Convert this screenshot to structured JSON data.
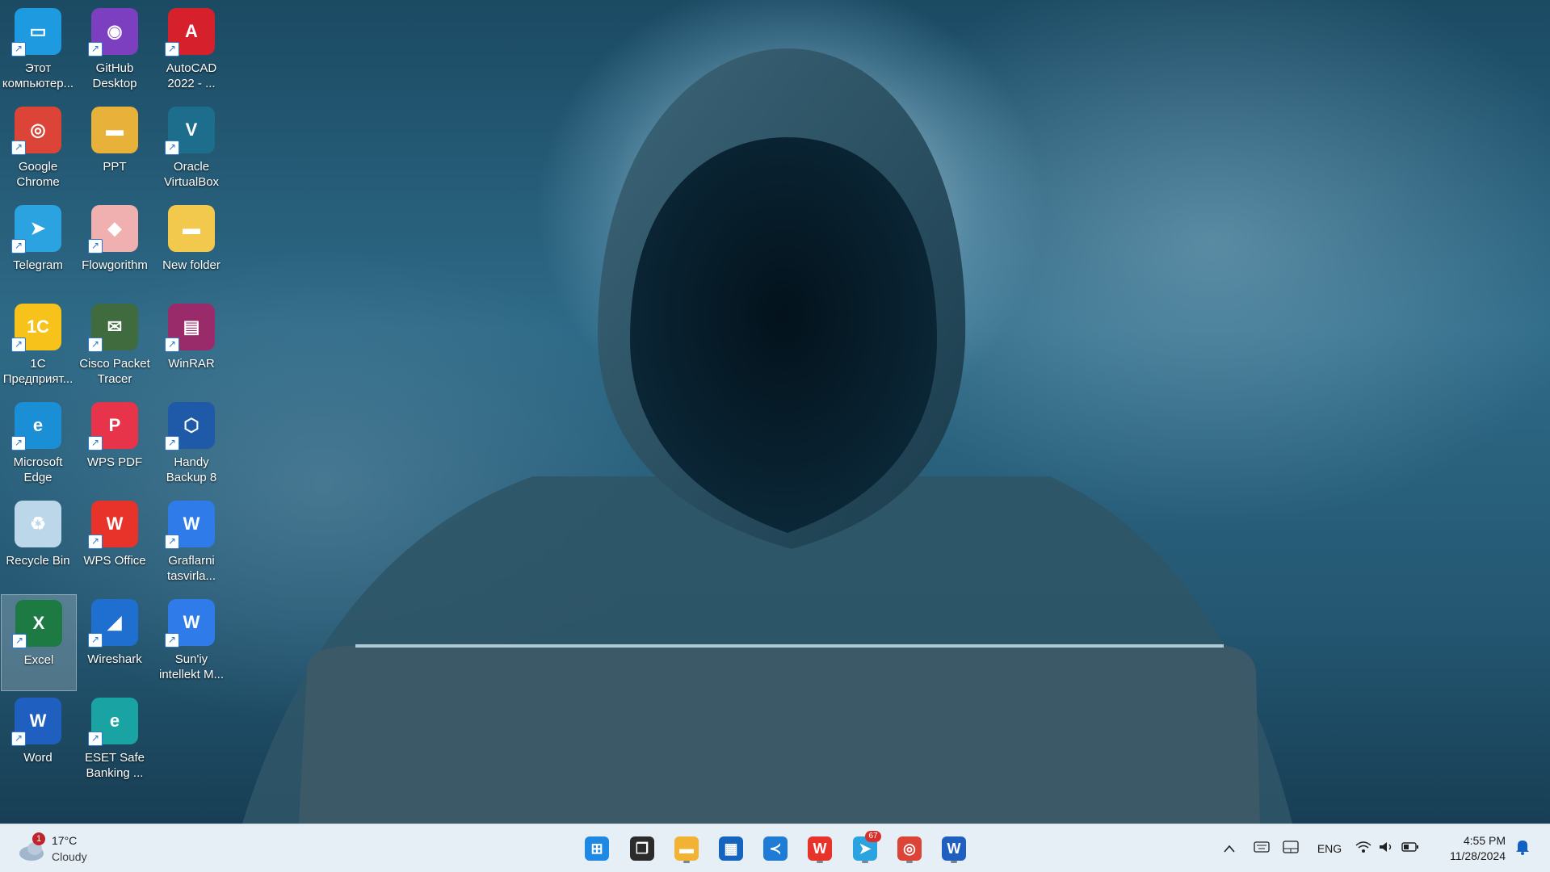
{
  "desktop": {
    "icons": [
      {
        "label": "Этот\nкомпьютер...",
        "icon": "computer-icon",
        "color": "#1e9be0"
      },
      {
        "label": "GitHub\nDesktop",
        "icon": "github-icon",
        "color": "#7b3fbf"
      },
      {
        "label": "AutoCAD\n2022 - ...",
        "icon": "autocad-icon",
        "color": "#d6202b"
      },
      {
        "label": "Google\nChrome",
        "icon": "chrome-icon",
        "color": "#db4437"
      },
      {
        "label": "PPT",
        "icon": "folder-icon",
        "color": "#e8b13a"
      },
      {
        "label": "Oracle\nVirtualBox",
        "icon": "virtualbox-icon",
        "color": "#1c6e8c"
      },
      {
        "label": "Telegram",
        "icon": "telegram-icon",
        "color": "#2aa3e0"
      },
      {
        "label": "Flowgorithm",
        "icon": "flowgorithm-icon",
        "color": "#f0b0b0"
      },
      {
        "label": "New folder",
        "icon": "folder-icon",
        "color": "#f2c94c"
      },
      {
        "label": "1C\nПредприят...",
        "icon": "1c-icon",
        "color": "#f7c21a"
      },
      {
        "label": "Cisco Packet\nTracer",
        "icon": "packet-tracer-icon",
        "color": "#3f6b3f"
      },
      {
        "label": "WinRAR",
        "icon": "winrar-icon",
        "color": "#9a2b6b"
      },
      {
        "label": "Microsoft\nEdge",
        "icon": "edge-icon",
        "color": "#1a8fd6"
      },
      {
        "label": "WPS PDF",
        "icon": "wps-pdf-icon",
        "color": "#e8344a"
      },
      {
        "label": "Handy\nBackup 8",
        "icon": "handy-backup-icon",
        "color": "#1e5aa8"
      },
      {
        "label": "Recycle Bin",
        "icon": "recycle-bin-icon",
        "color": "#bcd7ea"
      },
      {
        "label": "WPS Office",
        "icon": "wps-office-icon",
        "color": "#e8332a"
      },
      {
        "label": "Graflarni\ntasvirla...",
        "icon": "wps-doc-icon",
        "color": "#2f7bea"
      },
      {
        "label": "Excel",
        "icon": "excel-icon",
        "color": "#1d7a43"
      },
      {
        "label": "Wireshark",
        "icon": "wireshark-icon",
        "color": "#1e6fd0"
      },
      {
        "label": "Sun'iy\nintellekt M...",
        "icon": "wps-doc-icon",
        "color": "#2f7bea"
      },
      {
        "label": "Word",
        "icon": "word-icon",
        "color": "#1f5fbf"
      },
      {
        "label": "ESET Safe\nBanking ...",
        "icon": "eset-icon",
        "color": "#1aa3a3"
      }
    ]
  },
  "taskbar": {
    "weather": {
      "temp": "17°C",
      "desc": "Cloudy",
      "badge": "1"
    },
    "apps": [
      {
        "icon": "start-icon",
        "color": "#1e88e5"
      },
      {
        "icon": "task-view-icon",
        "color": "#2b2b2b"
      },
      {
        "icon": "file-explorer-icon",
        "color": "#f2b233"
      },
      {
        "icon": "store-icon",
        "color": "#1565c0"
      },
      {
        "icon": "vscode-icon",
        "color": "#1e7bd6"
      },
      {
        "icon": "wps-office-icon",
        "color": "#e8332a"
      },
      {
        "icon": "telegram-icon",
        "color": "#2aa3e0",
        "badge": "67"
      },
      {
        "icon": "chrome-icon",
        "color": "#db4437"
      },
      {
        "icon": "word-icon",
        "color": "#1f5fbf"
      }
    ],
    "tray": {
      "lang": "ENG",
      "time": "4:55 PM",
      "date": "11/28/2024"
    }
  }
}
